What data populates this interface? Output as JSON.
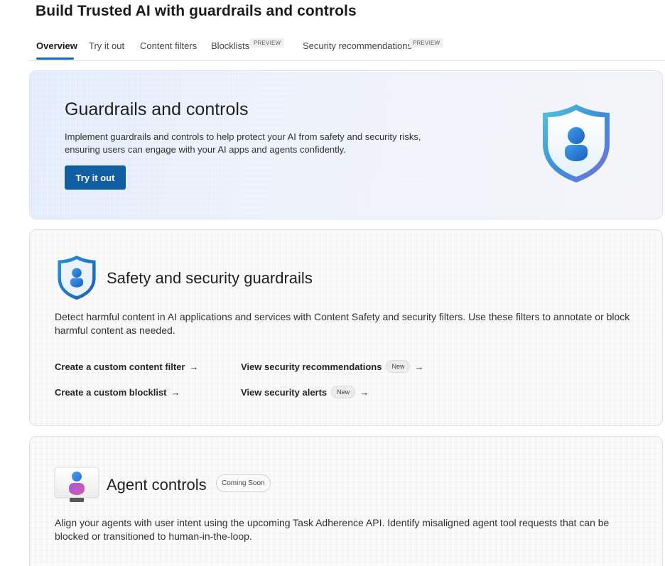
{
  "page": {
    "title": "Build Trusted AI with guardrails and controls"
  },
  "tabs": [
    {
      "label": "Overview",
      "active": true
    },
    {
      "label": "Try it out"
    },
    {
      "label": "Content filters"
    },
    {
      "label": "Blocklists",
      "badge": "PREVIEW"
    },
    {
      "label": "Security recommendations",
      "badge": "PREVIEW"
    }
  ],
  "hero": {
    "title": "Guardrails and controls",
    "description": "Implement guardrails and controls to help protect your AI from safety and security risks, ensuring users can engage with your AI apps and agents confidently.",
    "button_label": "Try it out",
    "icon": "shield-person-icon"
  },
  "safety": {
    "title": "Safety and security guardrails",
    "description": "Detect harmful content in AI applications and services with Content Safety and security filters. Use these filters to annotate or block harmful content as needed.",
    "icon": "shield-person-icon",
    "links": [
      {
        "label": "Create a custom content filter",
        "arrow": "→"
      },
      {
        "label": "Create a custom blocklist",
        "arrow": "→"
      },
      {
        "label": "View security recommendations",
        "badge": "New",
        "arrow": "→"
      },
      {
        "label": "View security alerts",
        "badge": "New",
        "arrow": "→"
      }
    ]
  },
  "agent": {
    "title": "Agent controls",
    "badge": "Coming Soon",
    "description": "Align your agents with user intent using the upcoming Task Adherence API. Identify misaligned agent tool requests that can be blocked or transitioned to human-in-the-loop.",
    "icon": "agent-person-icon"
  },
  "colors": {
    "accent": "#115ea3",
    "tab_underline": "#0f6cbd"
  }
}
